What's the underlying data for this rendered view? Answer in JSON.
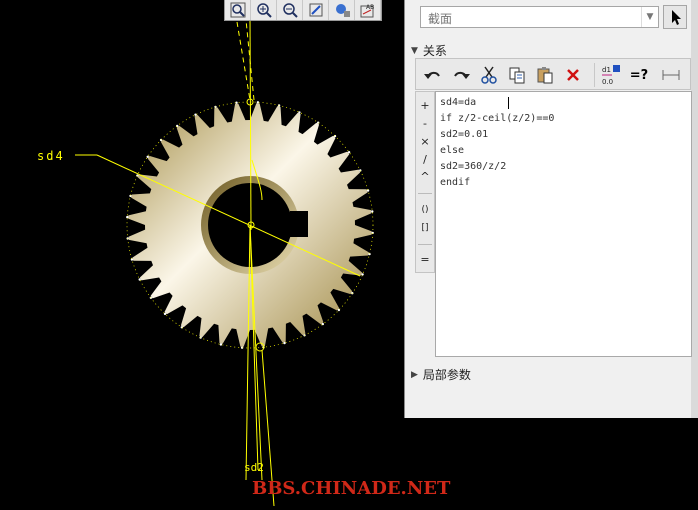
{
  "viewport": {
    "dimension_label_left": "sd4",
    "dimension_label_bottom": "sd2",
    "watermark": "BBS.CHINADE.NET",
    "colors": {
      "background": "#000000",
      "dimension_line": "#ffff00",
      "watermark": "#d02818",
      "gear_light": "#ffffff",
      "gear_dark": "#a38d45"
    }
  },
  "toolbar": {
    "tools": [
      {
        "name": "zoom-fit-icon"
      },
      {
        "name": "zoom-in-icon"
      },
      {
        "name": "zoom-out-icon"
      },
      {
        "name": "repaint-icon"
      },
      {
        "name": "orient-icon"
      },
      {
        "name": "annotation-display-icon"
      }
    ]
  },
  "panel": {
    "selector": {
      "value": "截面"
    },
    "relations_header": "关系",
    "editor_toolbar": {
      "tools": [
        "undo-icon",
        "redo-icon",
        "cut-icon",
        "copy-icon",
        "paste-icon",
        "delete-icon",
        "switch-dimensions-icon",
        "evaluate-icon",
        "measure-icon"
      ],
      "evaluate_label": "=?"
    },
    "operators": [
      "+",
      "-",
      "×",
      "/",
      "^",
      "()",
      "[]",
      "="
    ],
    "code_lines": [
      "sd4=da",
      "if z/2-ceil(z/2)==0",
      "sd2=0.01",
      "else",
      "sd2=360/z/2",
      "endif"
    ],
    "local_params_header": "局部参数"
  }
}
